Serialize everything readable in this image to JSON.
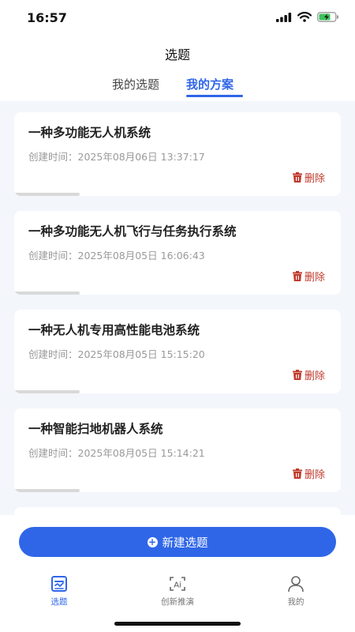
{
  "status_bar": {
    "time": "16:57"
  },
  "header": {
    "title": "选题",
    "tabs": [
      {
        "label": "我的选题",
        "active": false
      },
      {
        "label": "我的方案",
        "active": true
      }
    ]
  },
  "cards": [
    {
      "title": "一种多功能无人机系统",
      "time_label": "创建时间：",
      "time": "2025年08月06日 13:37:17",
      "delete_label": "删除"
    },
    {
      "title": "一种多功能无人机飞行与任务执行系统",
      "time_label": "创建时间：",
      "time": "2025年08月05日 16:06:43",
      "delete_label": "删除"
    },
    {
      "title": "一种无人机专用高性能电池系统",
      "time_label": "创建时间：",
      "time": "2025年08月05日 15:15:20",
      "delete_label": "删除"
    },
    {
      "title": "一种智能扫地机器人系统",
      "time_label": "创建时间：",
      "time": "2025年08月05日 15:14:21",
      "delete_label": "删除"
    }
  ],
  "new_topic_button": {
    "label": "新建选题"
  },
  "nav": [
    {
      "label": "选题",
      "icon": "topic-icon",
      "active": true
    },
    {
      "label": "创新推演",
      "icon": "ai-innovation-icon",
      "active": false
    },
    {
      "label": "我的",
      "icon": "profile-icon",
      "active": false
    }
  ],
  "colors": {
    "accent": "#2f66e8",
    "delete": "#c0392b"
  }
}
